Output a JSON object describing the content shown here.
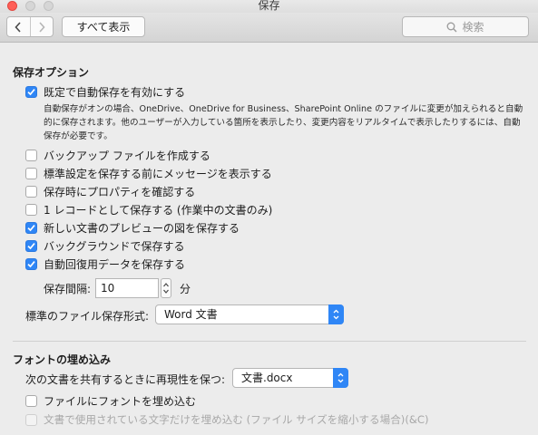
{
  "window": {
    "title": "保存"
  },
  "toolbar": {
    "show_all": "すべて表示",
    "search_placeholder": "検索"
  },
  "save_options": {
    "title": "保存オプション",
    "autosave": {
      "label": "既定で自動保存を有効にする",
      "checked": true
    },
    "autosave_description": "自動保存がオンの場合、OneDrive、OneDrive for Business、SharePoint Online のファイルに変更が加えられると自動的に保存されます。他のユーザーが入力している箇所を表示したり、変更内容をリアルタイムで表示したりするには、自動保存が必要です。",
    "options": [
      {
        "label": "バックアップ ファイルを作成する",
        "checked": false
      },
      {
        "label": "標準設定を保存する前にメッセージを表示する",
        "checked": false
      },
      {
        "label": "保存時にプロパティを確認する",
        "checked": false
      },
      {
        "label": "1 レコードとして保存する (作業中の文書のみ)",
        "checked": false
      },
      {
        "label": "新しい文書のプレビューの図を保存する",
        "checked": true
      },
      {
        "label": "バックグラウンドで保存する",
        "checked": true
      },
      {
        "label": "自動回復用データを保存する",
        "checked": true
      }
    ],
    "interval": {
      "label": "保存間隔:",
      "value": "10",
      "unit": "分"
    },
    "default_format": {
      "label": "標準のファイル保存形式:",
      "value": "Word 文書"
    }
  },
  "font_embedding": {
    "title": "フォントの埋め込み",
    "preserve_label": "次の文書を共有するときに再現性を保つ:",
    "document": "文書.docx",
    "embed_fonts": {
      "label": "ファイルにフォントを埋め込む",
      "checked": false
    },
    "embed_used_only": {
      "label": "文書で使用されている文字だけを埋め込む (ファイル サイズを縮小する場合)(&C)",
      "checked": false
    }
  },
  "colors": {
    "accent": "#2f86f6",
    "window_bg": "#ececec",
    "close_button": "#ff5f57"
  }
}
